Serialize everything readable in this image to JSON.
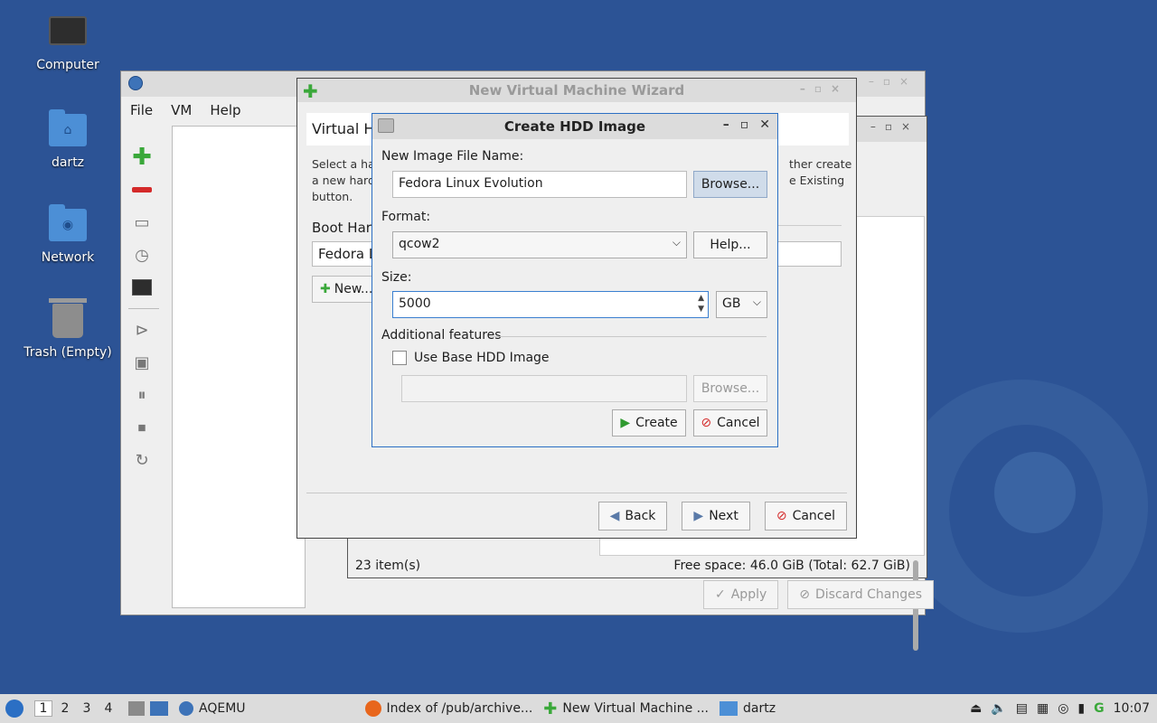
{
  "desktop": {
    "icons": [
      {
        "label": "Computer"
      },
      {
        "label": "dartz"
      },
      {
        "label": "Network"
      },
      {
        "label": "Trash (Empty)"
      }
    ]
  },
  "main_window": {
    "menu": [
      "File",
      "VM",
      "Help"
    ],
    "actions": {
      "apply": "Apply",
      "discard": "Discard Changes"
    }
  },
  "file_window": {
    "status_items": "23 item(s)",
    "status_free": "Free space: 46.0 GiB (Total: 62.7 GiB)"
  },
  "wizard": {
    "title": "New Virtual Machine Wizard",
    "header": "Virtual Ha",
    "desc_left": "Select a har\na new hard \nbutton.",
    "desc_right": "ther create\ne Existing",
    "boot_label": "Boot Hard",
    "boot_value": "Fedora L",
    "new_button": "New...",
    "back_button": "Back",
    "next_button": "Next",
    "cancel_button": "Cancel"
  },
  "hdd_dialog": {
    "title": "Create HDD Image",
    "file_name_label": "New Image File Name:",
    "file_name_value": "Fedora Linux Evolution",
    "browse_button": "Browse...",
    "format_label": "Format:",
    "format_value": "qcow2",
    "help_button": "Help...",
    "size_label": "Size:",
    "size_value": "5000",
    "size_unit": "GB",
    "additional_label": "Additional features",
    "use_base_label": "Use Base HDD Image",
    "base_browse_button": "Browse...",
    "create_button": "Create",
    "cancel_button": "Cancel"
  },
  "taskbar": {
    "workspaces": [
      "1",
      "2",
      "3",
      "4"
    ],
    "tasks": [
      {
        "label": "AQEMU"
      },
      {
        "label": "Index of /pub/archive..."
      },
      {
        "label": "New Virtual Machine ..."
      },
      {
        "label": "dartz"
      }
    ],
    "clock": "10:07"
  },
  "colors": {
    "desktop_bg": "#2c5395",
    "accent": "#2b6fc4",
    "green_plus": "#3aa83a",
    "red_cancel": "#d42a2a"
  }
}
